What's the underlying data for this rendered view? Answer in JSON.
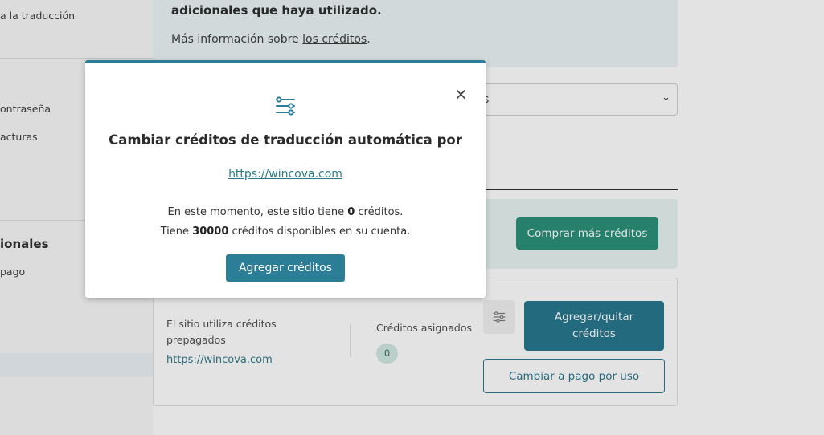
{
  "sidebar": {
    "links": [
      {
        "label": "a la traducción"
      },
      {
        "label": "ontraseña"
      },
      {
        "label": "acturas"
      }
    ],
    "heading": "ionales",
    "link_pago": "pago"
  },
  "info": {
    "strong_text": "adicionales que haya utilizado.",
    "more_prefix": "Más información sobre ",
    "more_link": "los créditos",
    "more_suffix": "."
  },
  "select": {
    "value": "s"
  },
  "buy_panel": {
    "button_label": "Comprar más créditos"
  },
  "site_card": {
    "description": "El sitio utiliza créditos prepagados",
    "site_link": "https://wincova.com",
    "assigned_label": "Créditos asignados",
    "assigned_value": "0",
    "add_remove_label": "Agregar/quitar créditos",
    "payg_label": "Cambiar a pago por uso"
  },
  "modal": {
    "icon": "sliders-icon",
    "close_glyph": "×",
    "title": "Cambiar créditos de traducción automática por",
    "site_link": "https://wincova.com",
    "line1_prefix": "En este momento, este sitio tiene ",
    "line1_value": "0",
    "line1_suffix": " créditos.",
    "line2_prefix": "Tiene ",
    "line2_value": "30000",
    "line2_suffix": " créditos disponibles en su cuenta.",
    "button_label": "Agregar créditos"
  },
  "colors": {
    "accent": "#2c7d96",
    "buy_button": "#1f8a70",
    "dark_button": "#1c6f87"
  }
}
